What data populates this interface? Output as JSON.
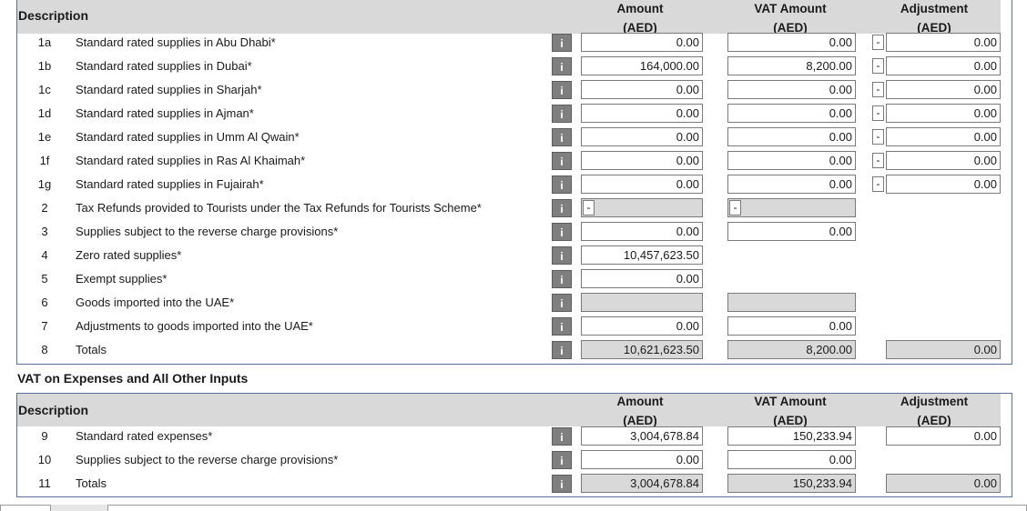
{
  "section1": {
    "desc_header": "Description",
    "col_amount": [
      "Amount",
      "(AED)"
    ],
    "col_vat": [
      "VAT Amount",
      "(AED)"
    ],
    "col_adjust": [
      "Adjustment",
      "(AED)"
    ],
    "info_glyph": "i",
    "rows": [
      {
        "num": "1a",
        "label": "Standard rated supplies in Abu Dhabi*",
        "amount": "0.00",
        "vat": "0.00",
        "adj_sign": "-",
        "adj": "0.00"
      },
      {
        "num": "1b",
        "label": "Standard rated supplies in Dubai*",
        "amount": "164,000.00",
        "vat": "8,200.00",
        "adj_sign": "-",
        "adj": "0.00"
      },
      {
        "num": "1c",
        "label": "Standard rated supplies in Sharjah*",
        "amount": "0.00",
        "vat": "0.00",
        "adj_sign": "-",
        "adj": "0.00"
      },
      {
        "num": "1d",
        "label": "Standard rated supplies in Ajman*",
        "amount": "0.00",
        "vat": "0.00",
        "adj_sign": "-",
        "adj": "0.00"
      },
      {
        "num": "1e",
        "label": "Standard rated supplies in Umm Al Qwain*",
        "amount": "0.00",
        "vat": "0.00",
        "adj_sign": "-",
        "adj": "0.00"
      },
      {
        "num": "1f",
        "label": "Standard rated supplies in Ras Al Khaimah*",
        "amount": "0.00",
        "vat": "0.00",
        "adj_sign": "-",
        "adj": "0.00"
      },
      {
        "num": "1g",
        "label": "Standard rated supplies in Fujairah*",
        "amount": "0.00",
        "vat": "0.00",
        "adj_sign": "-",
        "adj": "0.00"
      },
      {
        "num": "2",
        "label": "Tax Refunds provided to Tourists under the Tax Refunds for Tourists Scheme*",
        "amount_sign": "-",
        "vat_sign": "-"
      },
      {
        "num": "3",
        "label": "Supplies subject to the reverse charge provisions*",
        "amount": "0.00",
        "vat": "0.00"
      },
      {
        "num": "4",
        "label": "Zero rated supplies*",
        "amount": "10,457,623.50"
      },
      {
        "num": "5",
        "label": "Exempt supplies*",
        "amount": "0.00"
      },
      {
        "num": "6",
        "label": "Goods imported into the UAE*"
      },
      {
        "num": "7",
        "label": "Adjustments to goods imported into the UAE*",
        "amount": "0.00",
        "vat": "0.00"
      },
      {
        "num": "8",
        "label": "Totals",
        "amount": "10,621,623.50",
        "vat": "8,200.00",
        "adj": "0.00"
      }
    ]
  },
  "section2": {
    "title": "VAT on Expenses and All Other Inputs",
    "desc_header": "Description",
    "col_amount": [
      "Amount",
      "(AED)"
    ],
    "col_vat": [
      "VAT Amount",
      "(AED)"
    ],
    "col_adjust": [
      "Adjustment",
      "(AED)"
    ],
    "rows": [
      {
        "num": "9",
        "label": "Standard rated expenses*",
        "amount": "3,004,678.84",
        "vat": "150,233.94",
        "adj": "0.00"
      },
      {
        "num": "10",
        "label": "Supplies subject to the reverse charge provisions*",
        "amount": "0.00",
        "vat": "0.00"
      },
      {
        "num": "11",
        "label": "Totals",
        "amount": "3,004,678.84",
        "vat": "150,233.94",
        "adj": "0.00"
      }
    ]
  }
}
